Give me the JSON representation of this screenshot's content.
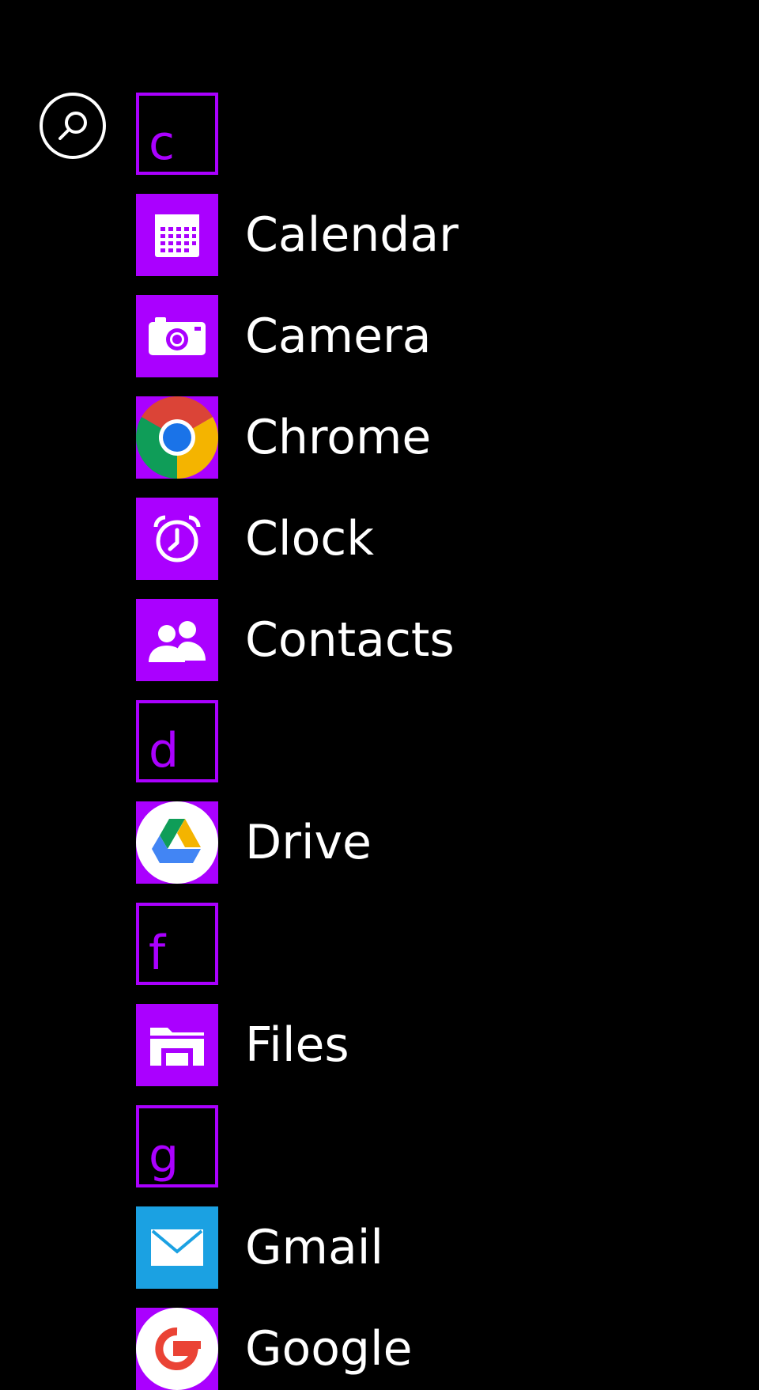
{
  "colors": {
    "background": "#000000",
    "accent": "#aa00ff",
    "gmail_tile": "#1ba1e2",
    "text": "#ffffff"
  },
  "search": {
    "icon": "search-icon"
  },
  "app_list": [
    {
      "kind": "header",
      "letter": "c"
    },
    {
      "kind": "app",
      "label": "Calendar",
      "icon": "calendar-icon"
    },
    {
      "kind": "app",
      "label": "Camera",
      "icon": "camera-icon"
    },
    {
      "kind": "app",
      "label": "Chrome",
      "icon": "chrome-icon"
    },
    {
      "kind": "app",
      "label": "Clock",
      "icon": "alarm-clock-icon"
    },
    {
      "kind": "app",
      "label": "Contacts",
      "icon": "contacts-icon"
    },
    {
      "kind": "header",
      "letter": "d"
    },
    {
      "kind": "app",
      "label": "Drive",
      "icon": "google-drive-icon"
    },
    {
      "kind": "header",
      "letter": "f"
    },
    {
      "kind": "app",
      "label": "Files",
      "icon": "folder-icon"
    },
    {
      "kind": "header",
      "letter": "g"
    },
    {
      "kind": "app",
      "label": "Gmail",
      "icon": "mail-icon"
    },
    {
      "kind": "app",
      "label": "Google",
      "icon": "google-icon"
    }
  ]
}
